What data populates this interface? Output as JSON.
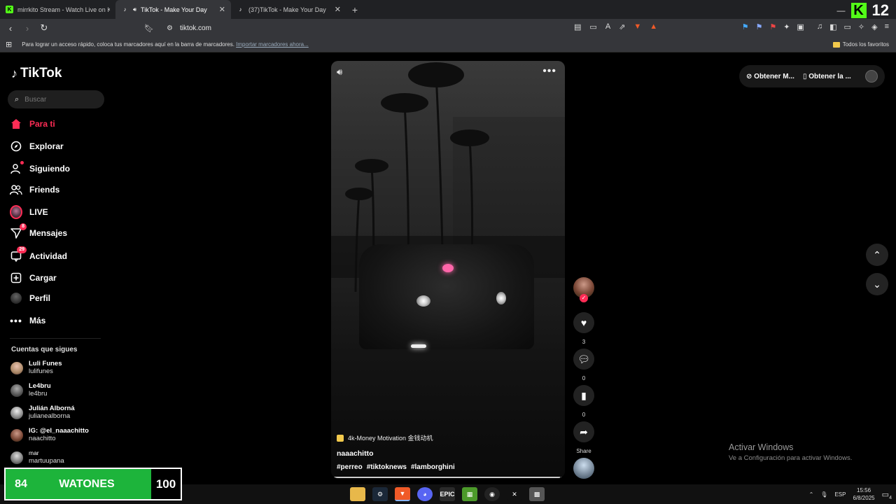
{
  "browser": {
    "tabs": [
      {
        "title": "mirrkito Stream - Watch Live on Kick",
        "favicon": "kick"
      },
      {
        "title": "TikTok - Make Your Day",
        "favicon": "tiktok",
        "active": true
      },
      {
        "title": "(37)TikTok - Make Your Day",
        "favicon": "tiktok"
      }
    ],
    "new_tab_icon": "+",
    "url": "tiktok.com",
    "bookmarks_hint": "Para lograr un acceso rápido, coloca tus marcadores aquí en la barra de marcadores.",
    "import_link": "Importar marcadores ahora...",
    "all_favorites": "Todos los favoritos",
    "kick_count": "12"
  },
  "tiktok": {
    "logo": "TikTok",
    "search_placeholder": "Buscar",
    "nav": [
      {
        "label": "Para ti",
        "icon": "home-icon",
        "active": true
      },
      {
        "label": "Explorar",
        "icon": "compass-icon"
      },
      {
        "label": "Siguiendo",
        "icon": "following-icon"
      },
      {
        "label": "Friends",
        "icon": "friends-icon"
      },
      {
        "label": "LIVE",
        "icon": "live-avatar"
      },
      {
        "label": "Mensajes",
        "icon": "messages-icon",
        "badge": "8"
      },
      {
        "label": "Actividad",
        "icon": "activity-icon",
        "badge": "29"
      },
      {
        "label": "Cargar",
        "icon": "upload-icon"
      },
      {
        "label": "Perfil",
        "icon": "profile-avatar"
      },
      {
        "label": "Más",
        "icon": "more-icon"
      }
    ],
    "following_title": "Cuentas que sigues",
    "following": [
      {
        "name": "Luli Funes",
        "user": "lulifunes"
      },
      {
        "name": "Le4bru",
        "user": "le4bru"
      },
      {
        "name": "Julián Alborná",
        "user": "julianealborna"
      },
      {
        "name": "IG: @el_naaachitto",
        "user": "naachitto"
      },
      {
        "name": "mar",
        "user": "martuupana"
      }
    ],
    "video": {
      "music": "4k-Money Motivation 金钱动机",
      "author": "naaachitto",
      "tags": [
        "#perreo",
        "#tiktoknews",
        "#lamborghini"
      ],
      "progress": 0.98
    },
    "actions": {
      "likes": "3",
      "comments": "0",
      "saves": "0",
      "share_label": "Share"
    },
    "top_right": {
      "btn1": "Obtener M...",
      "btn2": "Obtener la ..."
    }
  },
  "windows": {
    "activate_title": "Activar Windows",
    "activate_sub": "Ve a Configuración para activar Windows.",
    "lang": "ESP",
    "time": "15:56",
    "date": "6/8/2025",
    "notif_count": "4"
  },
  "overlay": {
    "left_num": "84",
    "label": "WATONES",
    "right_num": "100"
  }
}
